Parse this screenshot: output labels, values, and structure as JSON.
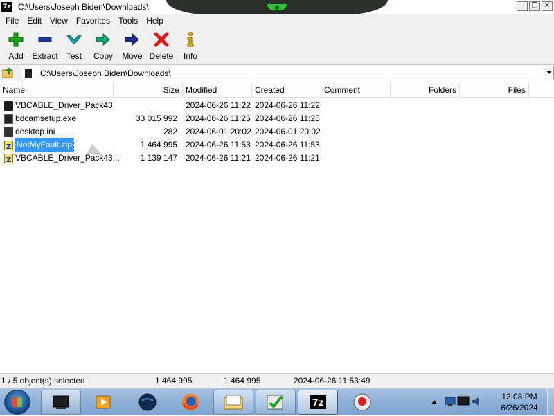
{
  "window": {
    "title": "C:\\Users\\Joseph Biden\\Downloads\\",
    "app_icon_text": "7z",
    "controls": [
      "minimize",
      "restore",
      "close"
    ]
  },
  "menu": [
    "File",
    "Edit",
    "View",
    "Favorites",
    "Tools",
    "Help"
  ],
  "toolbar": [
    {
      "label": "Add",
      "icon": "add-icon",
      "color": "#1f9d1f"
    },
    {
      "label": "Extract",
      "icon": "extract-icon",
      "color": "#1b3a9a"
    },
    {
      "label": "Test",
      "icon": "test-icon",
      "color": "#15a3b0"
    },
    {
      "label": "Copy",
      "icon": "copy-icon",
      "color": "#17a07a"
    },
    {
      "label": "Move",
      "icon": "move-icon",
      "color": "#1b2f8a"
    },
    {
      "label": "Delete",
      "icon": "delete-icon",
      "color": "#d41a1a"
    },
    {
      "label": "Info",
      "icon": "info-icon",
      "color": "#d9b500"
    }
  ],
  "address": {
    "path": "C:\\Users\\Joseph Biden\\Downloads\\"
  },
  "columns": [
    "Name",
    "Size",
    "Modified",
    "Created",
    "Comment",
    "Folders",
    "Files"
  ],
  "files": [
    {
      "name": "VBCABLE_Driver_Pack43",
      "size": "",
      "modified": "2024-06-26 11:22",
      "created": "2024-06-26 11:22",
      "icon": "folder-icon"
    },
    {
      "name": "bdcamsetup.exe",
      "size": "33 015 992",
      "modified": "2024-06-26 11:25",
      "created": "2024-06-26 11:25",
      "icon": "exe-icon"
    },
    {
      "name": "desktop.ini",
      "size": "282",
      "modified": "2024-06-01 20:02",
      "created": "2024-06-01 20:02",
      "icon": "ini-file-icon"
    },
    {
      "name": "NotMyFault.zip",
      "size": "1 464 995",
      "modified": "2024-06-26 11:53",
      "created": "2024-06-26 11:53",
      "icon": "zip-icon",
      "selected": true
    },
    {
      "name": "VBCABLE_Driver_Pack43...",
      "size": "1 139 147",
      "modified": "2024-06-26 11:21",
      "created": "2024-06-26 11:21",
      "icon": "zip-icon"
    }
  ],
  "status": {
    "selection": "1 / 5 object(s) selected",
    "size": "1 464 995",
    "packed": "1 464 995",
    "date": "2024-06-26 11:53:49"
  },
  "taskbar": {
    "apps": [
      "start-orb-icon",
      "window-icon",
      "media-player-icon",
      "browser-icon",
      "firefox-icon",
      "explorer-icon",
      "task-check-icon",
      "7zip-icon",
      "record-icon"
    ],
    "clock_time": "12:08 PM",
    "clock_date": "6/26/2024"
  }
}
